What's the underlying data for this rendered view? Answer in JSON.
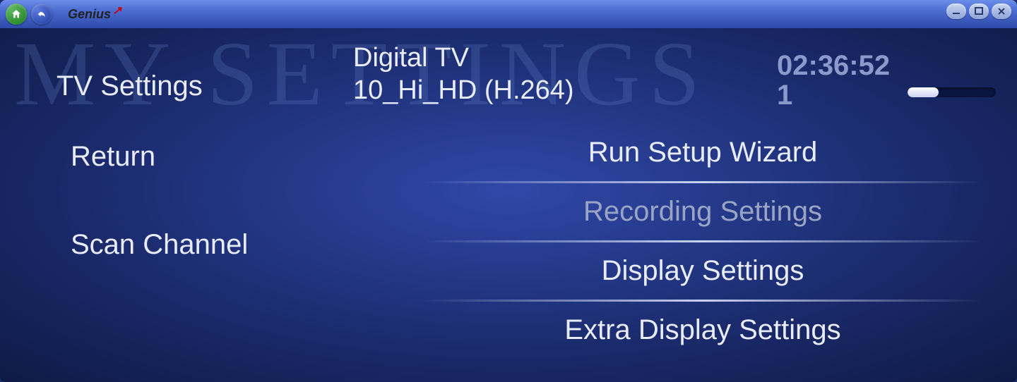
{
  "brand": "Genius",
  "watermark": "MY SETTINGS",
  "header": {
    "page_title": "TV Settings",
    "source_line1": "Digital TV",
    "source_line2": "10_Hi_HD (H.264)",
    "clock": "02:36:52",
    "signal_index": "1"
  },
  "left_menu": {
    "items": [
      {
        "label": "Return"
      },
      {
        "label": "Scan Channel"
      }
    ]
  },
  "right_menu": {
    "items": [
      {
        "label": "Run Setup Wizard",
        "selected": false
      },
      {
        "label": "Recording Settings",
        "selected": true
      },
      {
        "label": "Display Settings",
        "selected": false
      },
      {
        "label": "Extra Display Settings",
        "selected": false
      }
    ]
  }
}
